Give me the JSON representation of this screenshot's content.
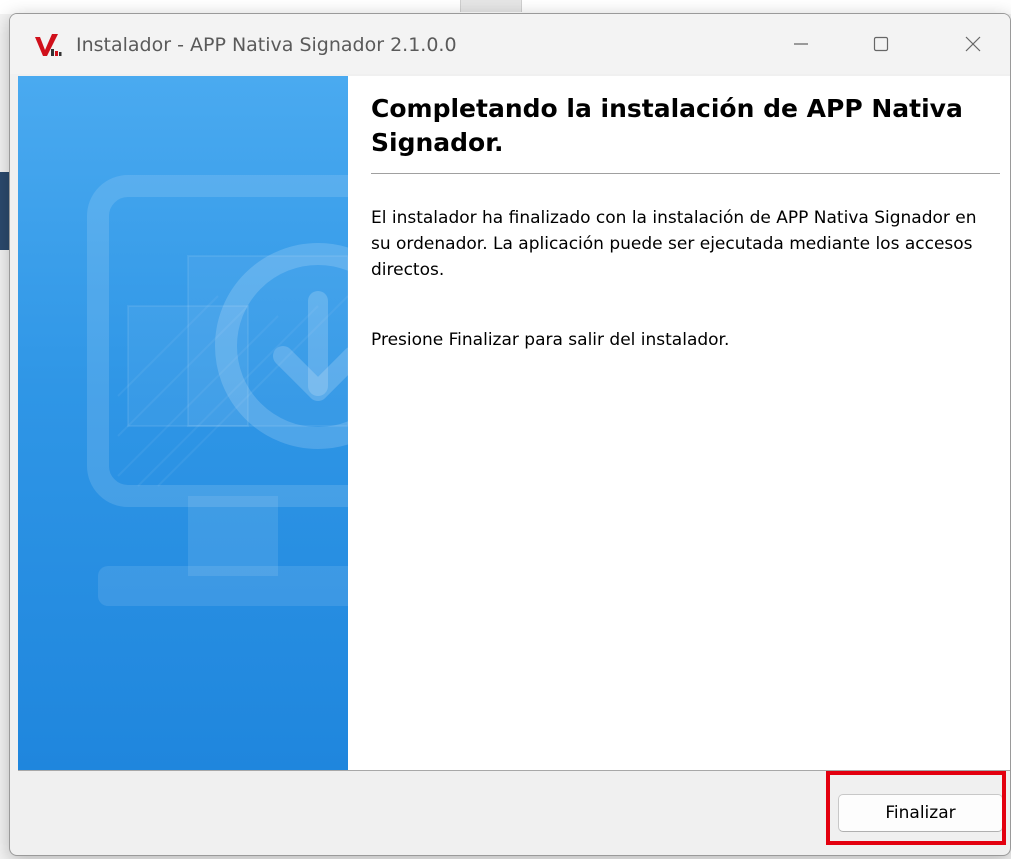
{
  "window": {
    "title": "Instalador - APP Nativa Signador 2.1.0.0",
    "controls": {
      "minimize": "—",
      "maximize": "☐",
      "close": "✕"
    }
  },
  "content": {
    "heading": "Completando la instalación de APP Nativa Signador.",
    "paragraph1": "El instalador ha finalizado con la instalación de APP Nativa Signador en su ordenador. La aplicación puede ser ejecutada mediante los accesos directos.",
    "paragraph2": "Presione Finalizar para salir del instalador."
  },
  "footer": {
    "finish_label": "Finalizar"
  },
  "colors": {
    "banner_top": "#4aaaf0",
    "banner_bottom": "#1f86dd",
    "highlight": "#e3000f",
    "app_icon_red": "#d0101b"
  },
  "icons": {
    "app": "app-logo-icon",
    "banner": "monitor-download-icon"
  }
}
